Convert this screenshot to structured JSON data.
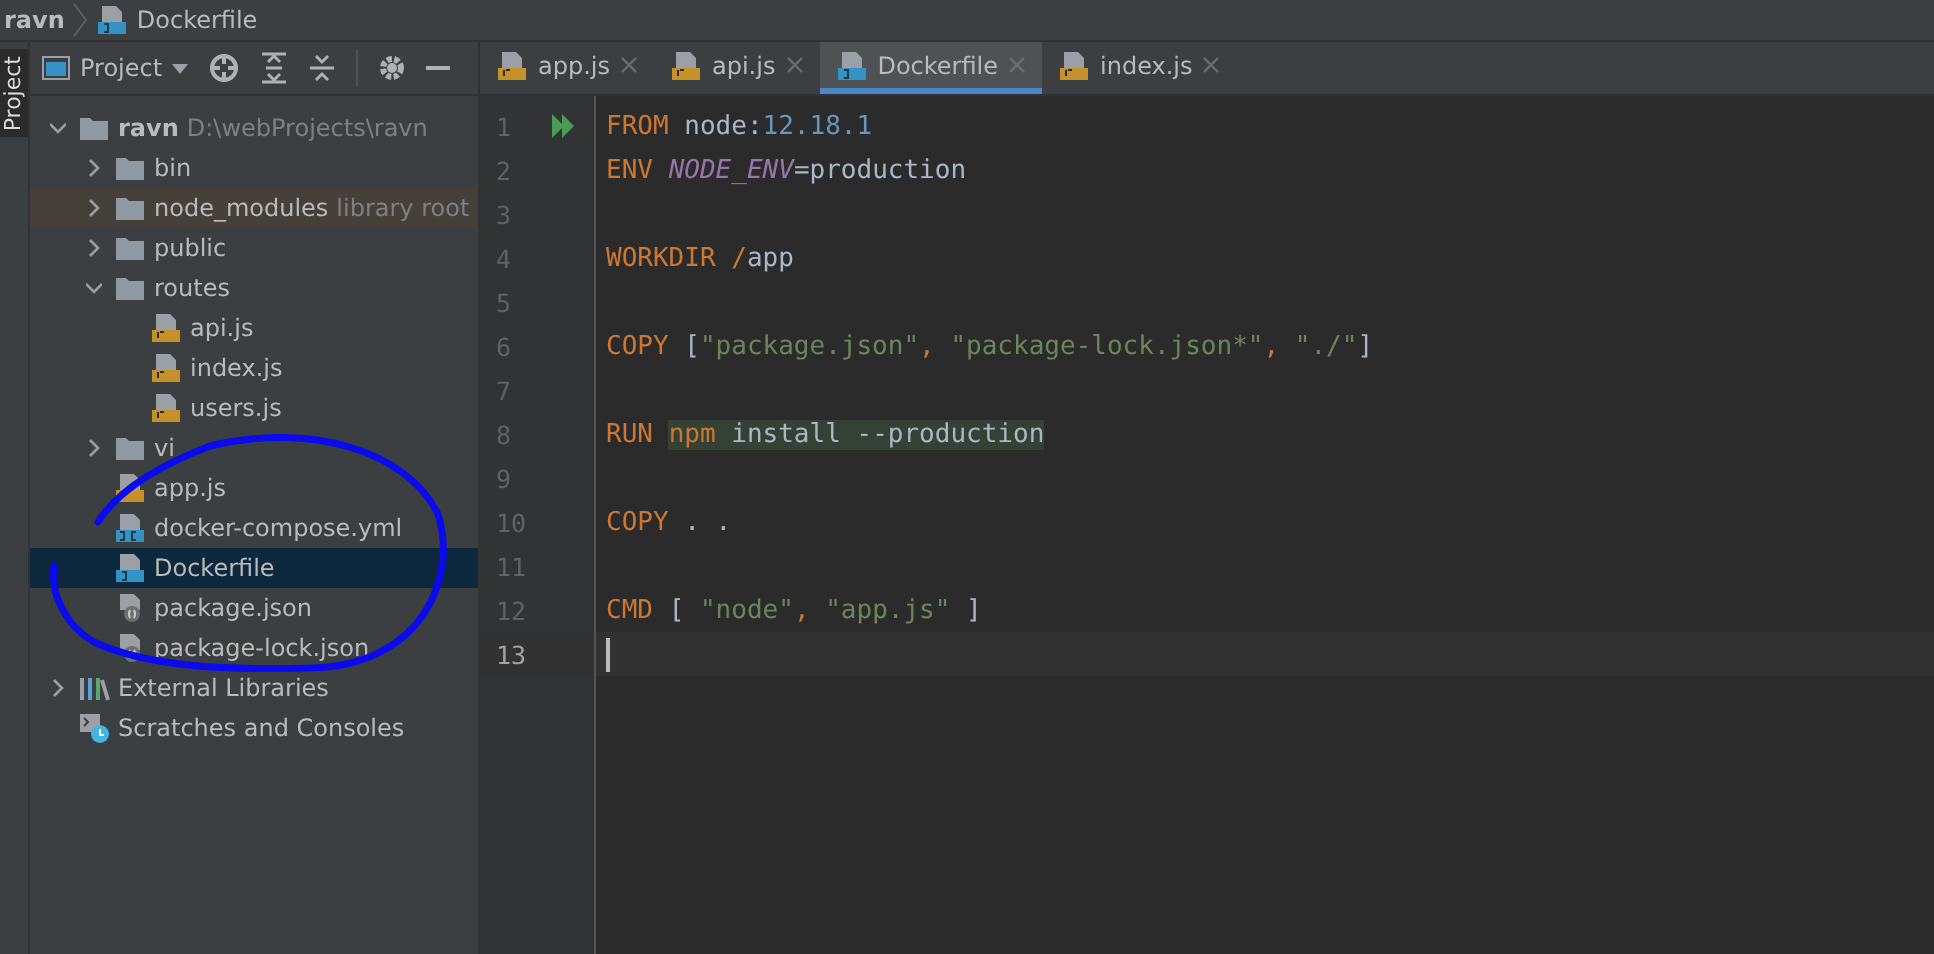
{
  "breadcrumb": [
    {
      "label": "ravn",
      "kind": "folder"
    },
    {
      "label": "Dockerfile",
      "kind": "docker"
    }
  ],
  "tool_strip": {
    "label": "Project"
  },
  "project_panel": {
    "title": "Project",
    "tree": [
      {
        "label": "ravn",
        "hint": "D:\\webProjects\\ravn",
        "kind": "root",
        "expanded": true,
        "selected": false,
        "children": [
          {
            "label": "bin",
            "kind": "folder",
            "expanded": false,
            "selected": false
          },
          {
            "label": "node_modules",
            "hint": "library root",
            "kind": "library",
            "expanded": false,
            "selected": false
          },
          {
            "label": "public",
            "kind": "folder",
            "expanded": false,
            "selected": false
          },
          {
            "label": "routes",
            "kind": "folder",
            "expanded": true,
            "selected": false,
            "children": [
              {
                "label": "api.js",
                "kind": "js",
                "selected": false
              },
              {
                "label": "index.js",
                "kind": "js",
                "selected": false
              },
              {
                "label": "users.js",
                "kind": "js",
                "selected": false
              }
            ]
          },
          {
            "label": "vi",
            "kind": "folder",
            "expanded": false,
            "selected": false
          },
          {
            "label": "app.js",
            "kind": "js",
            "selected": false
          },
          {
            "label": "docker-compose.yml",
            "kind": "compose",
            "selected": false
          },
          {
            "label": "Dockerfile",
            "kind": "docker",
            "selected": true
          },
          {
            "label": "package.json",
            "kind": "json",
            "selected": false
          },
          {
            "label": "package-lock.json",
            "kind": "json",
            "selected": false
          }
        ]
      },
      {
        "label": "External Libraries",
        "kind": "libraries",
        "expanded": false,
        "selected": false
      },
      {
        "label": "Scratches and Consoles",
        "kind": "scratches",
        "selected": false
      }
    ]
  },
  "tabs": [
    {
      "label": "app.js",
      "kind": "js",
      "selected": false
    },
    {
      "label": "api.js",
      "kind": "js",
      "selected": false
    },
    {
      "label": "Dockerfile",
      "kind": "docker",
      "selected": true
    },
    {
      "label": "index.js",
      "kind": "js",
      "selected": false
    }
  ],
  "editor": {
    "lines": [
      {
        "number": "1",
        "run": true,
        "current": false,
        "tokens": [
          {
            "text": "FROM",
            "kind": "keyword"
          },
          {
            "text": " node:",
            "kind": "plain"
          },
          {
            "text": "12.18.1",
            "kind": "number"
          }
        ]
      },
      {
        "number": "2",
        "run": false,
        "current": false,
        "tokens": [
          {
            "text": "ENV ",
            "kind": "keyword"
          },
          {
            "text": "NODE_ENV",
            "kind": "variable"
          },
          {
            "text": "=production",
            "kind": "plain"
          }
        ]
      },
      {
        "number": "3",
        "run": false,
        "current": false
      },
      {
        "number": "4",
        "run": false,
        "current": false,
        "tokens": [
          {
            "text": "WORKDIR /",
            "kind": "keyword"
          },
          {
            "text": "app",
            "kind": "plain"
          }
        ]
      },
      {
        "number": "5",
        "run": false,
        "current": false
      },
      {
        "number": "6",
        "run": false,
        "current": false,
        "tokens": [
          {
            "text": "COPY ",
            "kind": "keyword"
          },
          {
            "text": "[",
            "kind": "plain"
          },
          {
            "text": "\"package.json\"",
            "kind": "string"
          },
          {
            "text": ", ",
            "kind": "keyword"
          },
          {
            "text": "\"package-lock.json*\"",
            "kind": "string"
          },
          {
            "text": ", ",
            "kind": "keyword"
          },
          {
            "text": "\"./\"",
            "kind": "string"
          },
          {
            "text": "]",
            "kind": "plain"
          }
        ]
      },
      {
        "number": "7",
        "run": false,
        "current": false
      },
      {
        "number": "8",
        "run": false,
        "current": false,
        "tokens": [
          {
            "text": "RUN ",
            "kind": "keyword"
          },
          {
            "text": "npm",
            "kind": "command"
          },
          {
            "text": " install --production",
            "kind": "argument"
          }
        ]
      },
      {
        "number": "9",
        "run": false,
        "current": false
      },
      {
        "number": "10",
        "run": false,
        "current": false,
        "tokens": [
          {
            "text": "COPY ",
            "kind": "keyword"
          },
          {
            "text": ". .",
            "kind": "plain"
          }
        ]
      },
      {
        "number": "11",
        "run": false,
        "current": false
      },
      {
        "number": "12",
        "run": false,
        "current": false,
        "tokens": [
          {
            "text": "CMD ",
            "kind": "keyword"
          },
          {
            "text": "[ ",
            "kind": "plain"
          },
          {
            "text": "\"node\"",
            "kind": "string"
          },
          {
            "text": ", ",
            "kind": "keyword"
          },
          {
            "text": "\"app.js\"",
            "kind": "string"
          },
          {
            "text": " ]",
            "kind": "plain"
          }
        ]
      },
      {
        "number": "13",
        "run": false,
        "current": true
      }
    ]
  }
}
